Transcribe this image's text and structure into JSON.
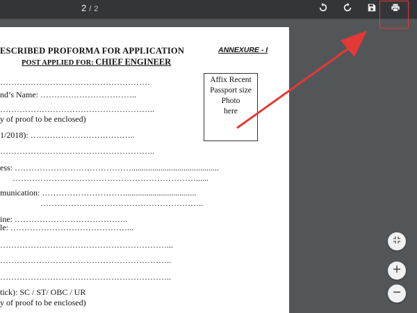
{
  "toolbar": {
    "current_page": "2",
    "separator": "/",
    "total_pages": "2",
    "icons": [
      "rotate-clockwise-icon",
      "rotate-counterclockwise-icon",
      "save-icon",
      "print-icon"
    ]
  },
  "document": {
    "title": "ESCRIBED PROFORMA FOR APPLICATION",
    "annexure": "ANNEXURE - I",
    "post_label": "POST APPLIED FOR: ",
    "post_role": "CHIEF ENGINEER",
    "photo_box": [
      "Affix Recent",
      "Passport size",
      "Photo",
      "here"
    ],
    "lines": [
      "………………………………………………",
      "nd’s Name: ……………………………..",
      "………………………………………………..",
      "y of proof to be enclosed)",
      "1/2018): ………………………………..",
      "………………………………………………..",
      "ess: ……………………………………..........................................",
      "…………………………………………………………......",
      "munication: …………………………..................................",
      "…………………………………………………..",
      "ine: …………………………………..",
      "le: ……………………………………...",
      "……………………………………………………...",
      "……………………………………………………..",
      "……………………………………………………..",
      " tick): SC / ST/ OBC / UR",
      "y of proof to be enclosed)"
    ]
  },
  "side_buttons": [
    "fit-to-page-icon",
    "zoom-in-icon",
    "zoom-out-icon"
  ],
  "annotation": {
    "arrow_color": "#e53935"
  }
}
